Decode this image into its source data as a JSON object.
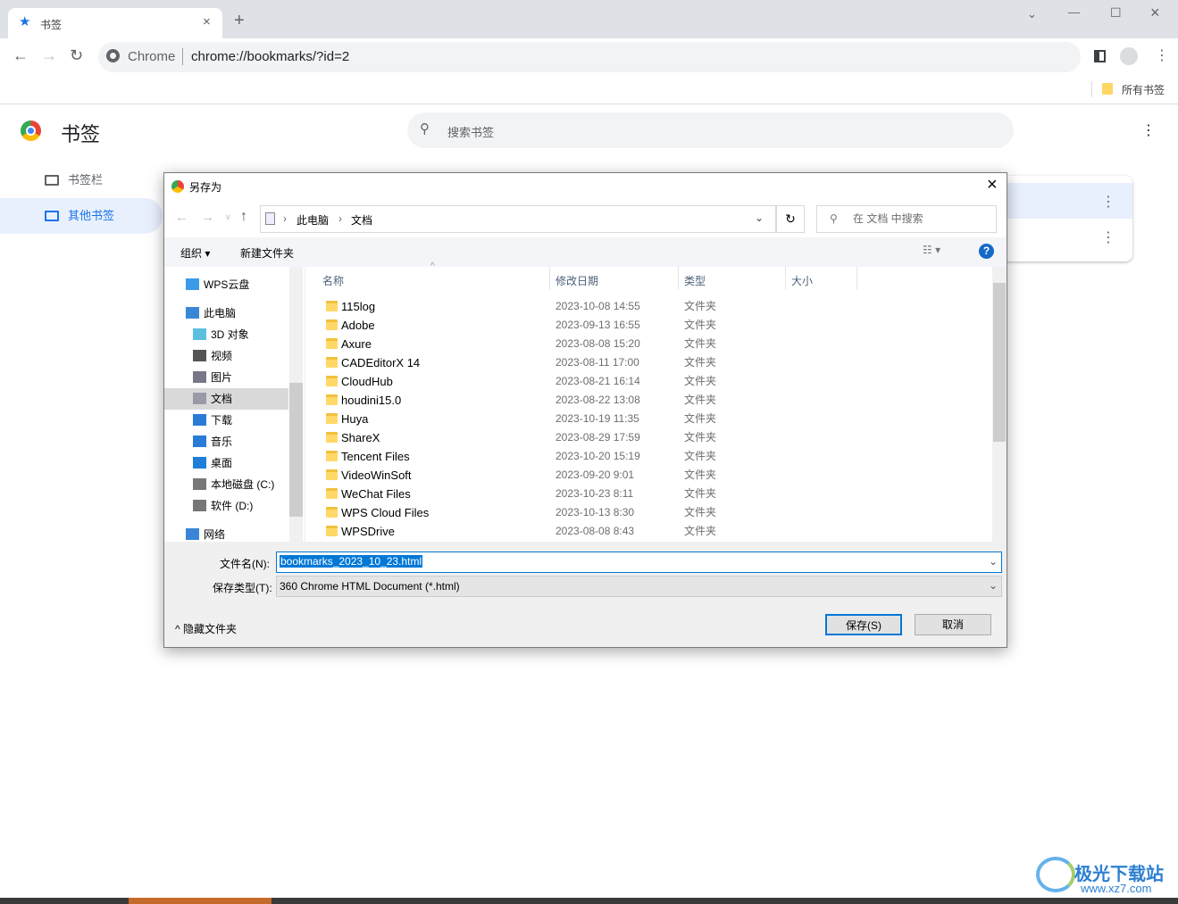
{
  "browser": {
    "tab_title": "书签",
    "address_prefix": "Chrome",
    "url": "chrome://bookmarks/?id=2",
    "bookmarks_bar_item": "所有书签"
  },
  "page": {
    "title": "书签",
    "search_placeholder": "搜索书签",
    "sidebar": [
      {
        "label": "书签栏"
      },
      {
        "label": "其他书签",
        "selected": true
      }
    ]
  },
  "dialog": {
    "title": "另存为",
    "breadcrumb": [
      "此电脑",
      "文档"
    ],
    "search_placeholder": "在 文档 中搜索",
    "organize": "组织",
    "new_folder": "新建文件夹",
    "nav": [
      {
        "label": "WPS云盘",
        "icon": "cloud-icon"
      },
      {
        "label": "此电脑",
        "icon": "computer-icon"
      },
      {
        "label": "3D 对象",
        "icon": "cube-icon"
      },
      {
        "label": "视频",
        "icon": "video-icon"
      },
      {
        "label": "图片",
        "icon": "picture-icon"
      },
      {
        "label": "文档",
        "icon": "document-icon",
        "selected": true
      },
      {
        "label": "下载",
        "icon": "download-icon"
      },
      {
        "label": "音乐",
        "icon": "music-icon"
      },
      {
        "label": "桌面",
        "icon": "desktop-icon"
      },
      {
        "label": "本地磁盘 (C:)",
        "icon": "drive-icon"
      },
      {
        "label": "软件 (D:)",
        "icon": "drive-icon"
      },
      {
        "label": "网络",
        "icon": "network-icon"
      }
    ],
    "columns": [
      "名称",
      "修改日期",
      "类型",
      "大小"
    ],
    "files": [
      {
        "name": "115log",
        "date": "2023-10-08 14:55",
        "type": "文件夹"
      },
      {
        "name": "Adobe",
        "date": "2023-09-13 16:55",
        "type": "文件夹"
      },
      {
        "name": "Axure",
        "date": "2023-08-08 15:20",
        "type": "文件夹"
      },
      {
        "name": "CADEditorX 14",
        "date": "2023-08-11 17:00",
        "type": "文件夹"
      },
      {
        "name": "CloudHub",
        "date": "2023-08-21 16:14",
        "type": "文件夹"
      },
      {
        "name": "houdini15.0",
        "date": "2023-08-22 13:08",
        "type": "文件夹"
      },
      {
        "name": "Huya",
        "date": "2023-10-19 11:35",
        "type": "文件夹"
      },
      {
        "name": "ShareX",
        "date": "2023-08-29 17:59",
        "type": "文件夹"
      },
      {
        "name": "Tencent Files",
        "date": "2023-10-20 15:19",
        "type": "文件夹"
      },
      {
        "name": "VideoWinSoft",
        "date": "2023-09-20 9:01",
        "type": "文件夹"
      },
      {
        "name": "WeChat Files",
        "date": "2023-10-23 8:11",
        "type": "文件夹"
      },
      {
        "name": "WPS Cloud Files",
        "date": "2023-10-13 8:30",
        "type": "文件夹"
      },
      {
        "name": "WPSDrive",
        "date": "2023-08-08 8:43",
        "type": "文件夹"
      }
    ],
    "filename_label": "文件名(N):",
    "filename": "bookmarks_2023_10_23.html",
    "filetype_label": "保存类型(T):",
    "filetype": "360 Chrome HTML Document (*.html)",
    "hide_folders": "隐藏文件夹",
    "save": "保存(S)",
    "cancel": "取消"
  },
  "watermark": {
    "text": "极光下载站",
    "url": "www.xz7.com"
  },
  "colors": {
    "accent": "#1a73e8",
    "selection": "#0078d7"
  }
}
